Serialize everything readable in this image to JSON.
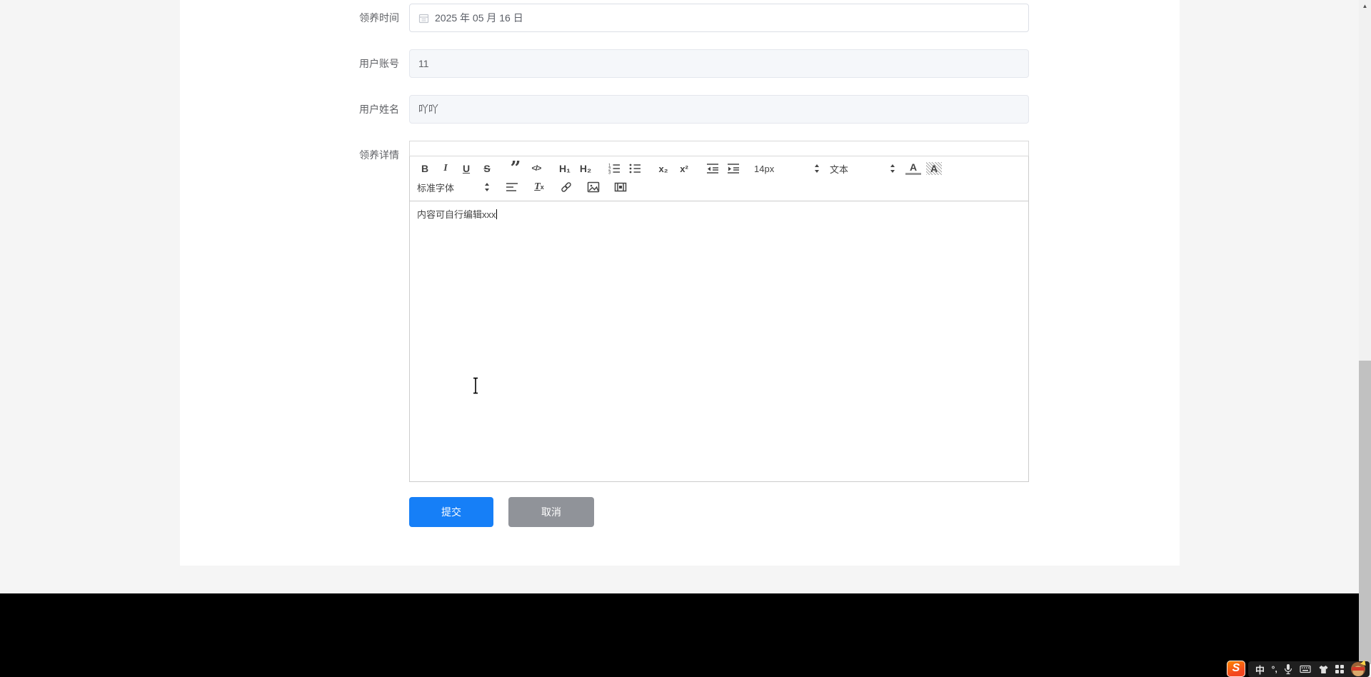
{
  "form": {
    "items": [
      {
        "label": "领养时间",
        "value": "2025 年 05 月 16 日",
        "type": "date"
      },
      {
        "label": "用户账号",
        "value": "11",
        "type": "text",
        "disabled": true
      },
      {
        "label": "用户姓名",
        "value": "吖吖",
        "type": "text",
        "disabled": true
      },
      {
        "label": "领养详情",
        "type": "richtext"
      }
    ]
  },
  "editor": {
    "content": "内容可自行编辑xxx",
    "toolbar": {
      "bold": "B",
      "italic": "I",
      "underline": "U",
      "strike": "S",
      "blockquote": "”",
      "code": "</>",
      "h1": "H₁",
      "h2": "H₂",
      "subscript": "x₂",
      "superscript": "x²",
      "font_size": "14px",
      "heading": "文本",
      "color": "A",
      "background": "A",
      "font_family": "标准字体",
      "clean_t": "T",
      "clean_x": "x"
    }
  },
  "actions": {
    "submit": "提交",
    "cancel": "取消"
  },
  "colors": {
    "primary": "#167ff7",
    "cancel_gray": "#909399",
    "page_bg": "#f5f5f5"
  },
  "taskbar": {
    "sogou_logo": "S",
    "ime_mode": "中",
    "ime_punct": "°,"
  }
}
